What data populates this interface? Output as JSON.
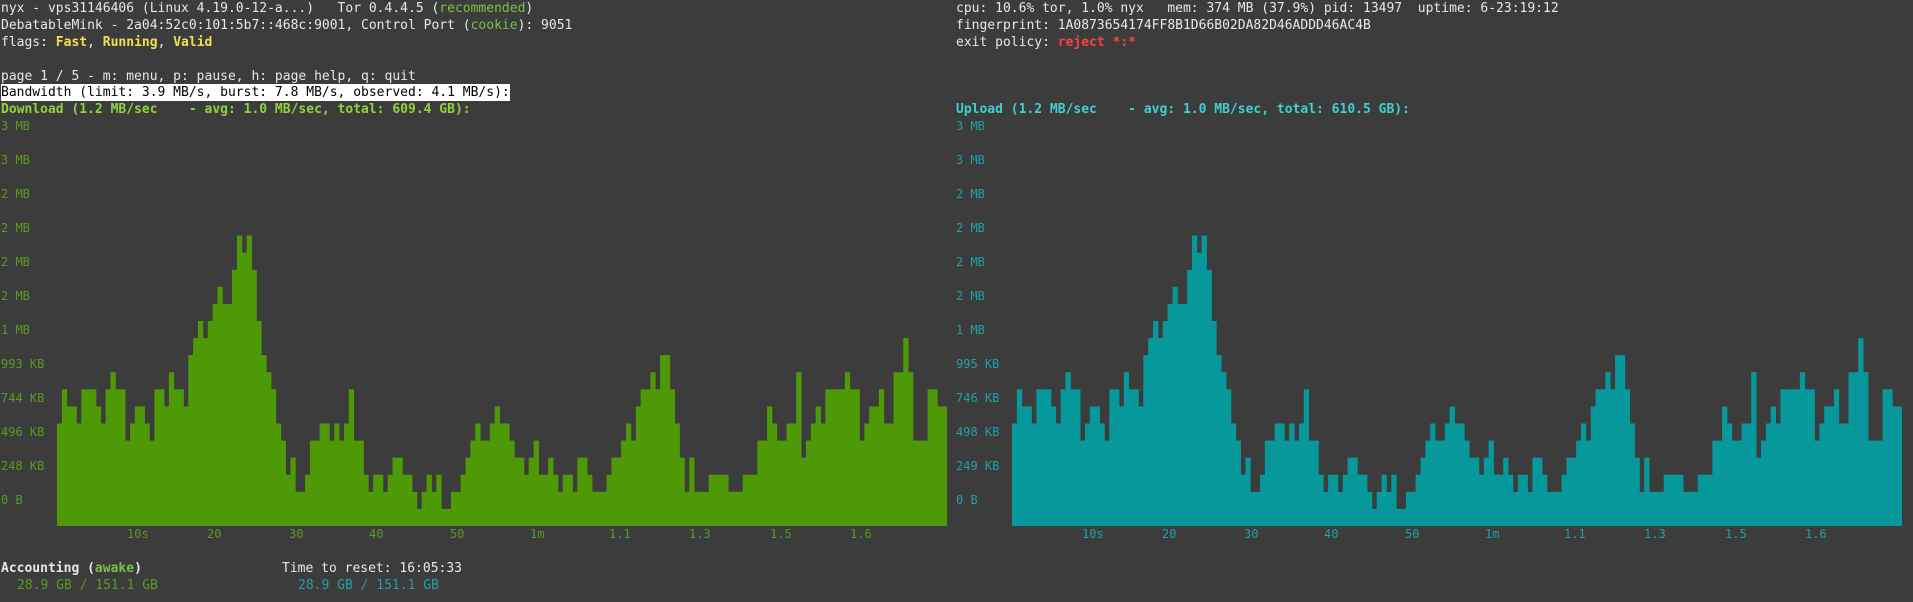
{
  "header": {
    "line1_a": "nyx - vps31146406 (Linux 4.19.0-12-a...)   Tor 0.4.4.5 (",
    "line1_b": "recommended",
    "line1_c": ")",
    "line2_a": "DebatableMink - 2a04:52c0:101:5b7::468c:9001, Control Port (",
    "line2_b": "cookie",
    "line2_c": "): 9051",
    "flags_label": "flags: ",
    "flag1": "Fast",
    "flag2": "Running",
    "flag3": "Valid",
    "sep": ", ",
    "right1": "cpu: 10.6% tor, 1.0% nyx   mem: 374 MB (37.9%) pid: 13497  uptime: 6-23:19:12",
    "right2": "fingerprint: 1A0873654174FF8B1D66B02DA82D46ADDD46AC4B",
    "exit_label": "exit policy: ",
    "exit_value": "reject *:*"
  },
  "nav": "page 1 / 5 - m: menu, p: pause, h: page help, q: quit",
  "bandwidth_title": "Bandwidth (limit: 3.9 MB/s, burst: 7.8 MB/s, observed: 4.1 MB/s):",
  "download": {
    "title": "Download (1.2 MB/sec    - avg: 1.0 MB/sec, total: 609.4 GB):",
    "ylabels": [
      "3 MB",
      "3 MB",
      "2 MB",
      "2 MB",
      "2 MB",
      "2 MB",
      "1 MB",
      "993 KB",
      "744 KB",
      "496 KB",
      "248 KB",
      "0 B"
    ],
    "values": [
      6,
      8,
      7,
      7,
      6,
      8,
      8,
      8,
      7,
      6,
      8,
      9,
      8,
      8,
      5,
      6,
      7,
      7,
      6,
      5,
      8,
      8,
      7,
      9,
      8,
      8,
      7,
      10,
      11,
      12,
      11,
      12,
      13,
      14,
      13,
      13,
      15,
      17,
      16,
      17,
      15,
      12,
      10,
      9,
      8,
      6,
      5,
      3,
      4,
      2,
      2,
      3,
      5,
      5,
      6,
      6,
      5,
      6,
      5,
      6,
      8,
      5,
      5,
      3,
      2,
      3,
      3,
      2,
      3,
      4,
      4,
      3,
      3,
      2,
      1,
      2,
      3,
      2,
      3,
      1,
      1,
      2,
      2,
      3,
      4,
      5,
      6,
      5,
      5,
      6,
      7,
      6,
      6,
      5,
      4,
      4,
      3,
      4,
      5,
      3,
      3,
      4,
      3,
      2,
      3,
      3,
      2,
      4,
      4,
      3,
      2,
      2,
      2,
      3,
      4,
      4,
      5,
      6,
      5,
      7,
      8,
      8,
      9,
      8,
      10,
      10,
      8,
      6,
      4,
      2,
      4,
      2,
      2,
      2,
      3,
      3,
      3,
      3,
      2,
      2,
      2,
      3,
      3,
      3,
      5,
      5,
      7,
      6,
      5,
      5,
      6,
      6,
      9,
      4,
      5,
      6,
      7,
      6,
      8,
      8,
      8,
      8,
      9,
      8,
      8,
      5,
      6,
      7,
      7,
      8,
      6,
      6,
      9,
      9,
      11,
      9,
      5,
      5,
      5,
      8,
      8,
      7,
      7
    ],
    "total": "28.9 GB / 151.1 GB"
  },
  "upload": {
    "title": "Upload (1.2 MB/sec    - avg: 1.0 MB/sec, total: 610.5 GB):",
    "ylabels": [
      "3 MB",
      "3 MB",
      "2 MB",
      "2 MB",
      "2 MB",
      "2 MB",
      "1 MB",
      "995 KB",
      "746 KB",
      "498 KB",
      "249 KB",
      "0 B"
    ],
    "values": [
      6,
      8,
      7,
      7,
      6,
      8,
      8,
      8,
      7,
      6,
      8,
      9,
      8,
      8,
      5,
      6,
      7,
      7,
      6,
      5,
      8,
      8,
      7,
      9,
      8,
      8,
      7,
      10,
      11,
      12,
      11,
      12,
      13,
      14,
      13,
      13,
      15,
      17,
      16,
      17,
      15,
      12,
      10,
      9,
      8,
      6,
      5,
      3,
      4,
      2,
      2,
      3,
      5,
      5,
      6,
      6,
      5,
      6,
      5,
      6,
      8,
      5,
      5,
      3,
      2,
      3,
      3,
      2,
      3,
      4,
      4,
      3,
      3,
      2,
      1,
      2,
      3,
      2,
      3,
      1,
      1,
      2,
      2,
      3,
      4,
      5,
      6,
      5,
      5,
      6,
      7,
      6,
      6,
      5,
      4,
      4,
      3,
      4,
      5,
      3,
      3,
      4,
      3,
      2,
      3,
      3,
      2,
      4,
      4,
      3,
      2,
      2,
      2,
      3,
      4,
      4,
      5,
      6,
      5,
      7,
      8,
      8,
      9,
      8,
      10,
      10,
      8,
      6,
      4,
      2,
      4,
      2,
      2,
      2,
      3,
      3,
      3,
      3,
      2,
      2,
      2,
      3,
      3,
      3,
      5,
      5,
      7,
      6,
      5,
      5,
      6,
      6,
      9,
      4,
      5,
      6,
      7,
      6,
      8,
      8,
      8,
      8,
      9,
      8,
      8,
      5,
      6,
      7,
      7,
      8,
      6,
      6,
      9,
      9,
      11,
      9,
      5,
      5,
      5,
      8,
      8,
      7,
      7
    ],
    "total": "28.9 GB / 151.1 GB"
  },
  "xlabels": [
    "10s",
    "20",
    "30",
    "40",
    "50",
    "1m",
    "1.1",
    "1.3",
    "1.5",
    "1.6"
  ],
  "accounting": {
    "label": "Accounting (",
    "state": "awake",
    "close": ")",
    "reset": "Time to reset: 16:05:33"
  },
  "colors": {
    "download": "#4e9a06",
    "upload": "#06989a",
    "background": "#3c3c3c"
  }
}
